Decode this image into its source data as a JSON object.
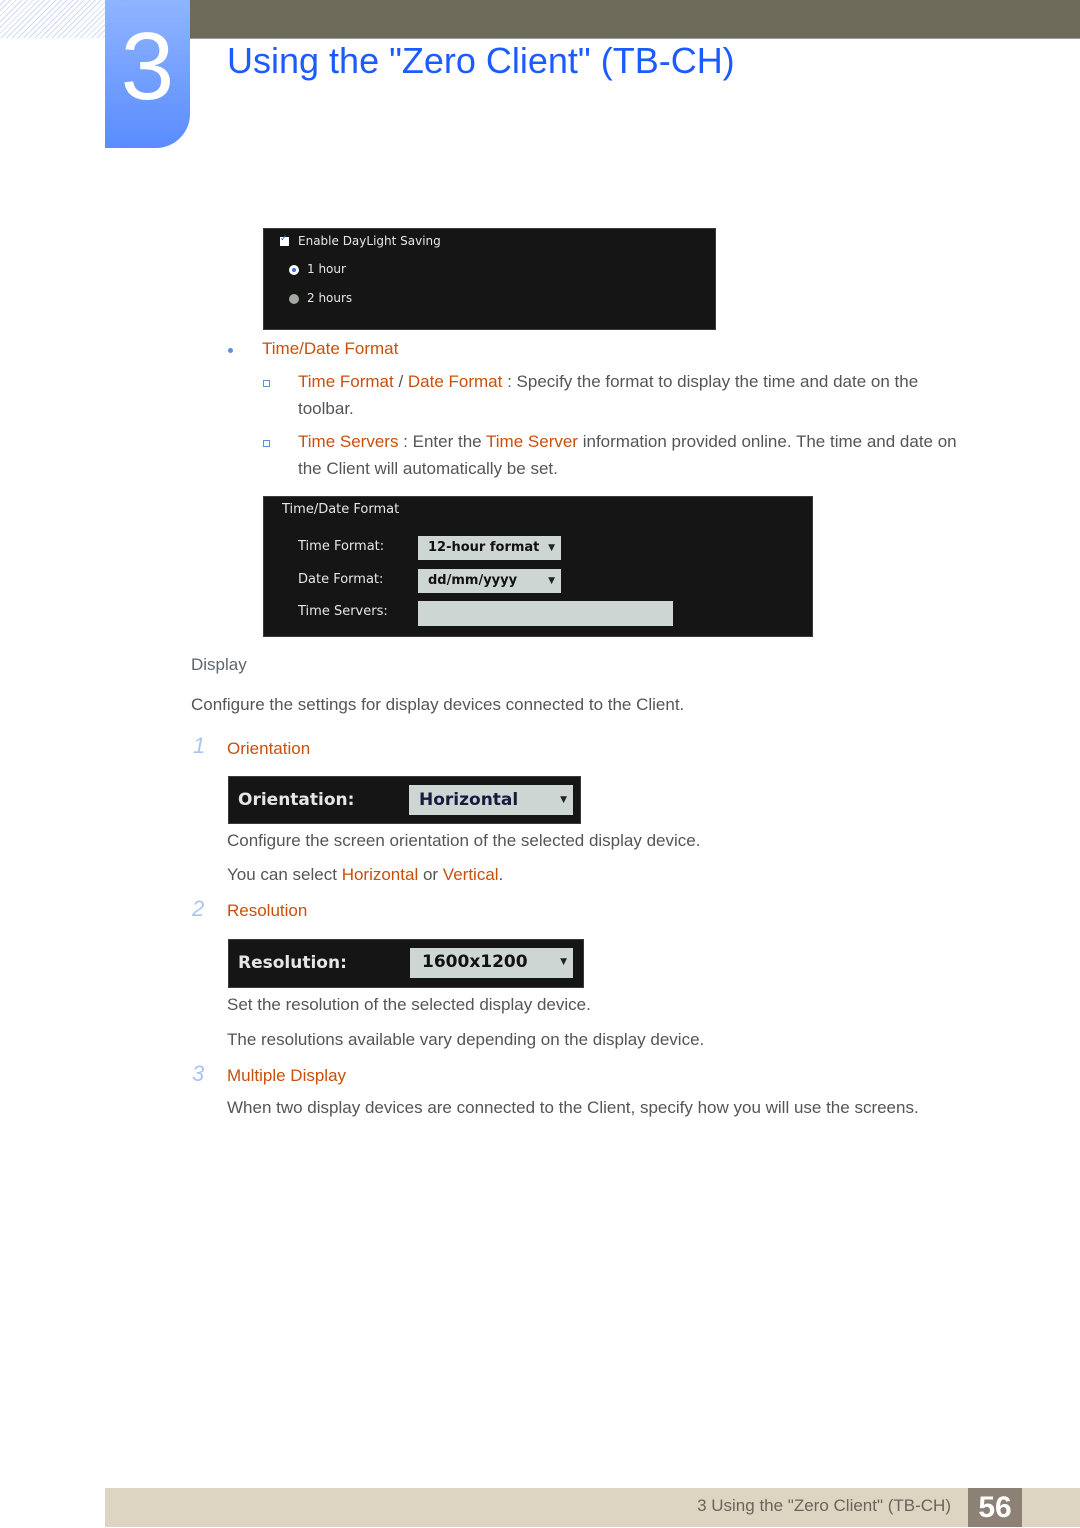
{
  "header": {
    "chapter_number": "3",
    "title": "Using the \"Zero Client\" (TB-CH)"
  },
  "daylight_panel": {
    "checkbox_label": "Enable DayLight Saving",
    "checkbox_checked": true,
    "options": [
      {
        "label": "1 hour",
        "selected": true
      },
      {
        "label": "2 hours",
        "selected": false
      }
    ]
  },
  "time_date": {
    "heading": "Time/Date Format",
    "items": [
      {
        "term1": "Time Format",
        "sep": " / ",
        "term2": "Date Format",
        "desc1": " : Specify the format to display the time and date on the",
        "desc2": "toolbar."
      },
      {
        "term1": "Time Servers",
        "mid": " : Enter the ",
        "term2": "Time Server",
        "desc1": " information provided online. The time and date on",
        "desc2": "the Client will automatically be set."
      }
    ],
    "panel": {
      "title": "Time/Date Format",
      "time_format_label": "Time Format:",
      "time_format_value": "12-hour format",
      "date_format_label": "Date Format:",
      "date_format_value": "dd/mm/yyyy",
      "time_servers_label": "Time Servers:",
      "time_servers_value": ""
    }
  },
  "display": {
    "heading": "Display",
    "intro": "Configure the settings for display devices connected to the Client.",
    "steps": [
      {
        "number": "1",
        "title": "Orientation",
        "panel_label": "Orientation:",
        "panel_value": "Horizontal",
        "lines": [
          "Configure the screen orientation of the selected display device."
        ],
        "select_prefix": "You can select ",
        "opt1": "Horizontal",
        "or": " or ",
        "opt2": "Vertical",
        "period": "."
      },
      {
        "number": "2",
        "title": "Resolution",
        "panel_label": "Resolution:",
        "panel_value": "1600x1200",
        "lines": [
          "Set the resolution of the selected display device.",
          "The resolutions available vary depending on the display device."
        ]
      },
      {
        "number": "3",
        "title": "Multiple Display",
        "lines": [
          "When two display devices are connected to the Client, specify how you will use the screens."
        ]
      }
    ]
  },
  "footer": {
    "text": "3 Using the \"Zero Client\" (TB-CH)",
    "page": "56"
  }
}
